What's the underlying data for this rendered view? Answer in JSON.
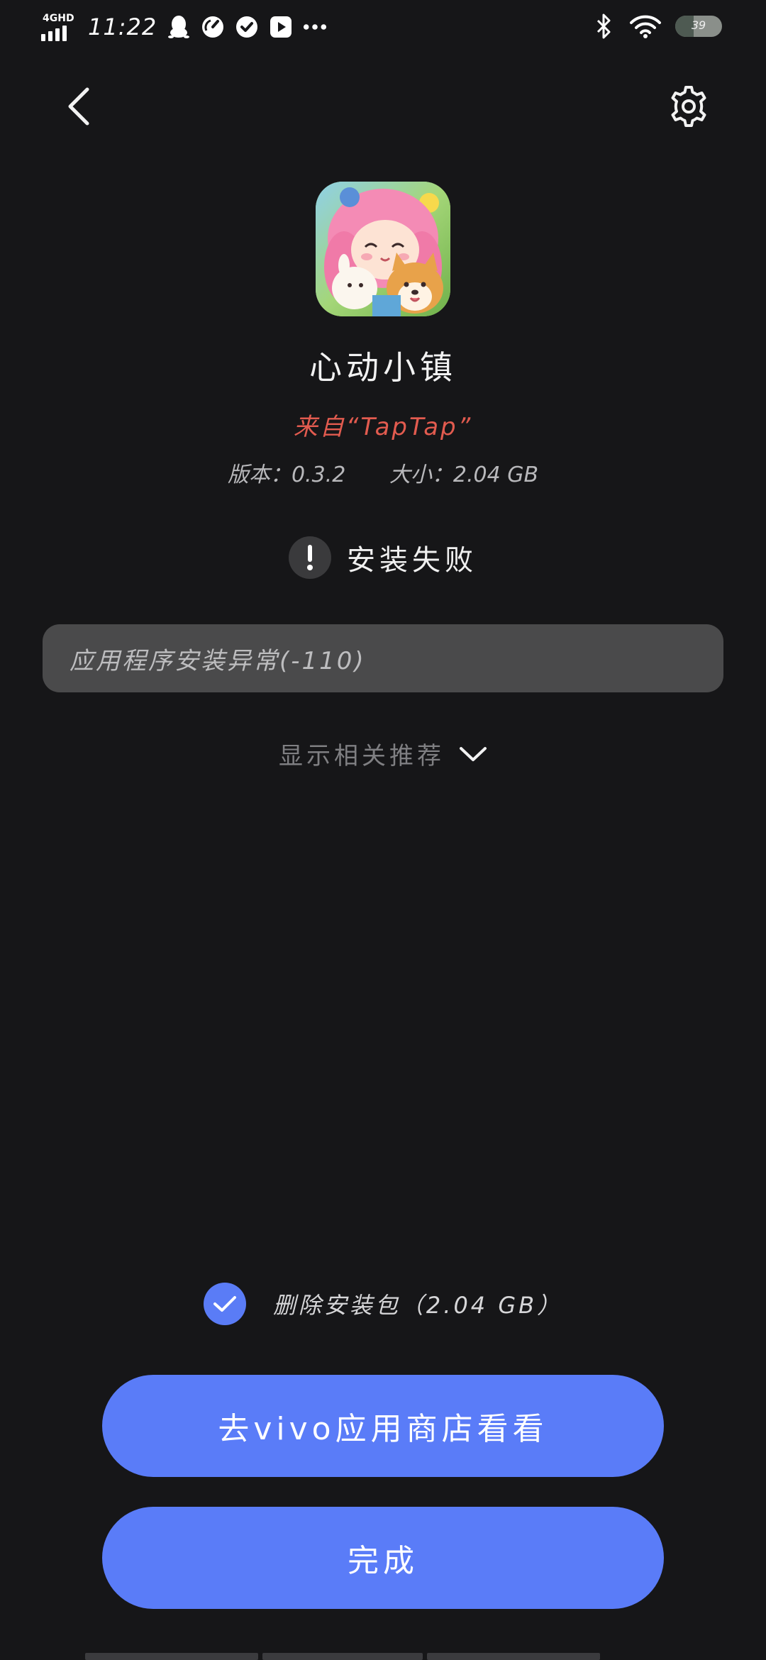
{
  "status_bar": {
    "network": "4GHD",
    "time": "11:22",
    "battery": "39",
    "battery_level": 0.39,
    "left_icons": [
      "qq-icon",
      "speedometer-icon",
      "check-circle-icon",
      "play-icon",
      "more-icon"
    ],
    "right_icons": [
      "bluetooth-icon",
      "wifi-icon",
      "battery-icon"
    ]
  },
  "header": {
    "back_icon": "chevron-left-icon",
    "settings_icon": "gear-icon"
  },
  "app": {
    "name": "心动小镇",
    "source": "来自“TapTap”",
    "version": "版本：0.3.2",
    "size": "大小：2.04 GB"
  },
  "install": {
    "status": "安装失败",
    "status_icon": "exclamation-icon",
    "error_message": "应用程序安装异常(-110)"
  },
  "recommend": {
    "label": "显示相关推荐"
  },
  "delete_package": {
    "label": "删除安装包（2.04 GB）",
    "checked": true
  },
  "buttons": {
    "store": "去vivo应用商店看看",
    "done": "完成"
  },
  "colors": {
    "background": "#161618",
    "accent": "#5a7cf8",
    "source_text": "#e25b4f",
    "error_box": "#4a4a4b"
  }
}
